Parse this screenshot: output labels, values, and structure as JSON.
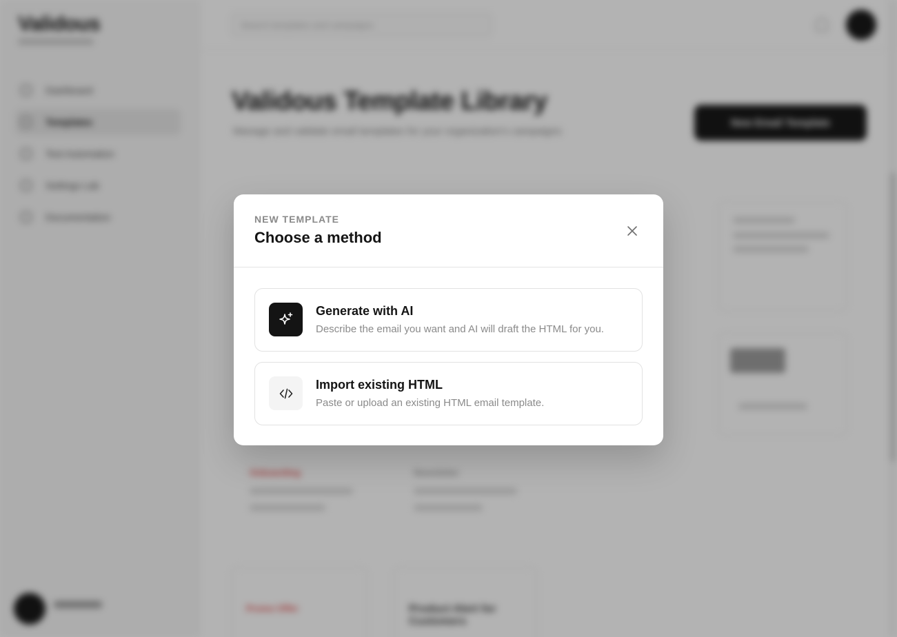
{
  "background": {
    "brand": "Validous",
    "nav_items": [
      "Dashboard",
      "Templates",
      "Test Automation",
      "Settings Lab",
      "Documentation"
    ],
    "search_placeholder": "Search templates and campaigns",
    "page_title": "Validous Template Library",
    "page_subtitle": "Manage and validate email templates for your organization's campaigns",
    "new_button_label": "New Email Template",
    "cards": [
      {
        "tag": "Onboarding",
        "tag_color": "#e24b4b"
      },
      {
        "tag": "Newsletter",
        "tag_color": "#999999"
      },
      {
        "tag": "Promo Offer",
        "tag_color": "#e24b4b"
      },
      {
        "tag": "Product Alert for Customers",
        "tag_color": "#333333"
      }
    ]
  },
  "modal": {
    "eyebrow": "NEW TEMPLATE",
    "title": "Choose a method",
    "options": [
      {
        "icon": "sparkles-icon",
        "title": "Generate with AI",
        "description": "Describe the email you want and AI will draft the HTML for you."
      },
      {
        "icon": "code-icon",
        "title": "Import existing HTML",
        "description": "Paste or upload an existing HTML email template."
      }
    ]
  },
  "colors": {
    "primary": "#141414",
    "muted_text": "#8a8a8a",
    "border": "#e2e2e2",
    "overlay": "rgba(20,20,20,0.32)"
  }
}
